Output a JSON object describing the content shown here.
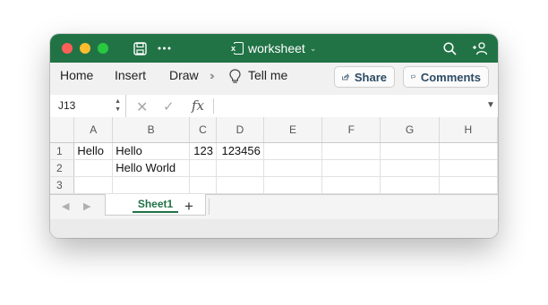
{
  "window": {
    "title": "worksheet"
  },
  "ribbon": {
    "tabs": [
      "Home",
      "Insert",
      "Draw"
    ],
    "tell_me": "Tell me",
    "share_label": "Share",
    "comments_label": "Comments"
  },
  "formula_bar": {
    "cell_ref": "J13",
    "fx": "fx",
    "value": ""
  },
  "grid": {
    "columns": [
      "A",
      "B",
      "C",
      "D",
      "E",
      "F",
      "G",
      "H"
    ],
    "rows": [
      {
        "num": "1",
        "cells": [
          "Hello",
          "Hello",
          "123",
          "123456",
          "",
          "",
          "",
          ""
        ]
      },
      {
        "num": "2",
        "cells": [
          "",
          "Hello World",
          "",
          "",
          "",
          "",
          "",
          ""
        ]
      },
      {
        "num": "3",
        "cells": [
          "",
          "",
          "",
          "",
          "",
          "",
          "",
          ""
        ]
      }
    ]
  },
  "sheets": {
    "active": "Sheet1",
    "add": "+"
  },
  "colors": {
    "accent": "#217346"
  }
}
